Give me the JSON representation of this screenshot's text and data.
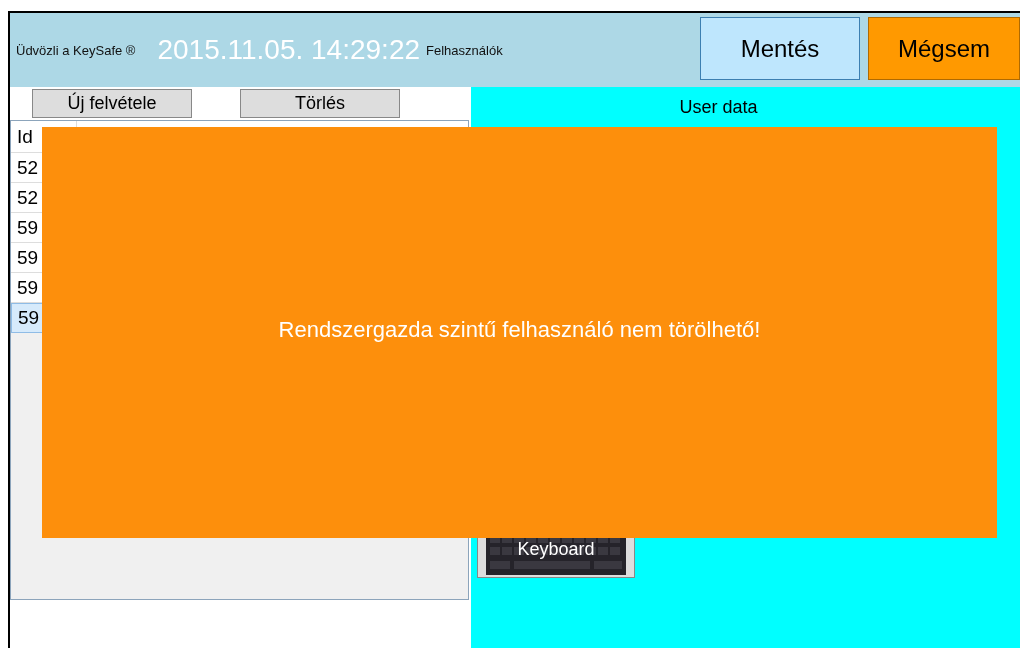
{
  "header": {
    "welcome": "Üdvözli a KeySafe ®",
    "clock": "2015.11.05. 14:29:22",
    "section": "Felhasználók",
    "buttons": [
      {
        "label": "Mentés",
        "kind": "save"
      },
      {
        "label": "Mégsem",
        "kind": "cancel"
      }
    ]
  },
  "toolbar": {
    "buttons": [
      "Új felvétele",
      "Törlés"
    ]
  },
  "table": {
    "columns": [
      "Id"
    ],
    "rows": [
      {
        "id": "52",
        "selected": false
      },
      {
        "id": "52",
        "selected": false
      },
      {
        "id": "59",
        "selected": false
      },
      {
        "id": "59",
        "selected": false
      },
      {
        "id": "59",
        "selected": false
      },
      {
        "id": "59",
        "selected": true
      }
    ]
  },
  "user_data": {
    "title": "User data",
    "keyboard_button": "Keyboard"
  },
  "message": "Rendszergazda szintű felhasználó nem törölhető!"
}
